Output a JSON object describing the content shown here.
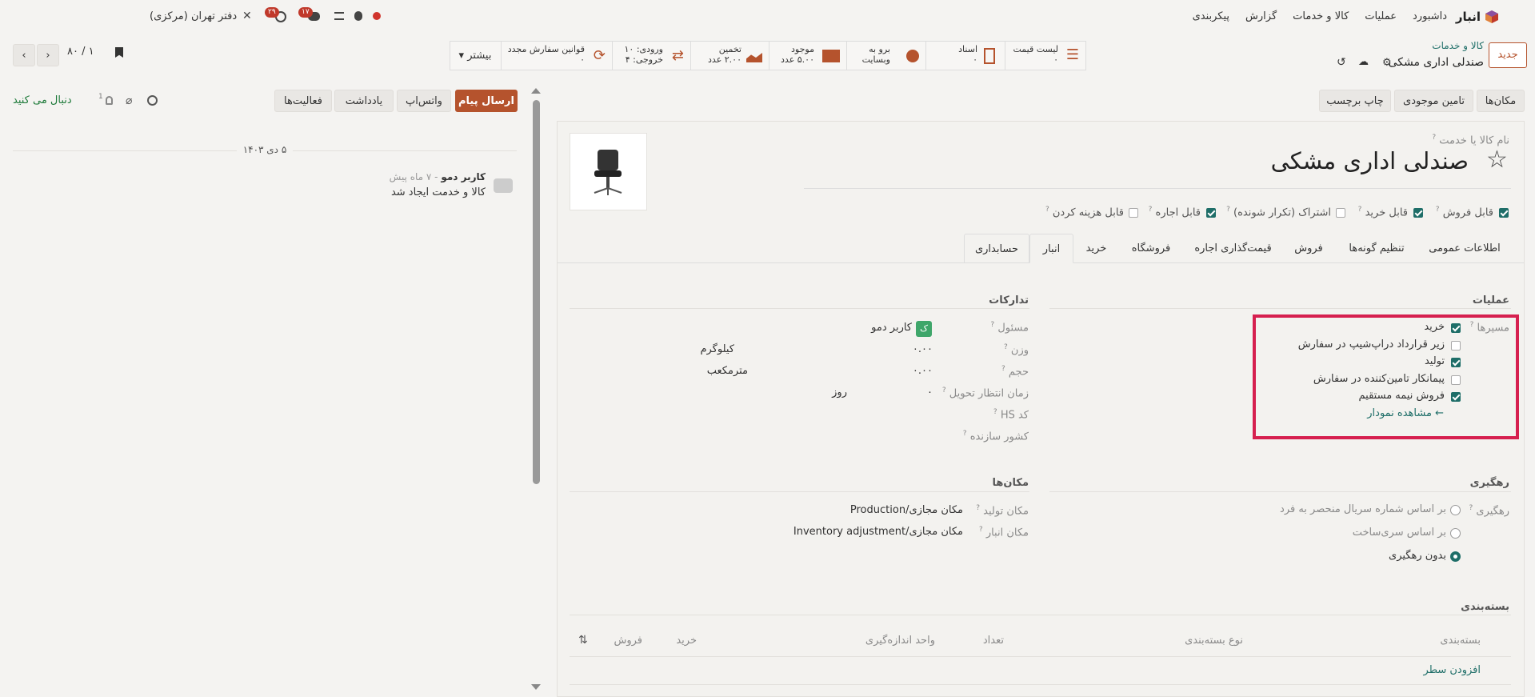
{
  "topbar": {
    "app_name": "انبار",
    "menu": [
      "داشبورد",
      "عملیات",
      "کالا و خدمات",
      "گزارش",
      "پیکربندی"
    ],
    "company": "دفتر تهران (مرکزی)",
    "badge_activity": "۲۹",
    "badge_messages": "۱۷"
  },
  "breadcrumb": {
    "parent": "کالا و خدمات",
    "current": "صندلی اداری مشکی"
  },
  "new_button": "جدید",
  "stats": [
    {
      "label": "لیست قیمت",
      "value": "۰"
    },
    {
      "label": "اسناد",
      "value": "۰"
    },
    {
      "label": "برو به",
      "value": "وبسایت"
    },
    {
      "label": "موجود",
      "value": "۵.۰۰ عدد"
    },
    {
      "label": "تخمین",
      "value": "۲.۰۰ عدد"
    },
    {
      "label": "ورودی: ۱۰",
      "value": "خروجی: ۴"
    },
    {
      "label": "قوانین سفارش مجدد",
      "value": "۰"
    }
  ],
  "more_button": "بیشتر",
  "pager": "۱ / ۸۰",
  "actions": [
    "مکان‌ها",
    "تامین موجودی",
    "چاپ برچسب"
  ],
  "chatter": {
    "send_message": "ارسال پیام",
    "whatsapp": "واتس‌اپ",
    "note": "یادداشت",
    "activities": "فعالیت‌ها",
    "follow": "دنبال می کنید",
    "followers_count": "1",
    "date": "۵ دی ۱۴۰۳",
    "author": "کاربر دمو",
    "time_ago": "- ۷ ماه پیش",
    "message": "کالا و خدمت ایجاد شد"
  },
  "form": {
    "name_label": "نام کالا یا خدمت",
    "product_name": "صندلی اداری مشکی",
    "options": [
      {
        "label": "قابل فروش",
        "checked": true
      },
      {
        "label": "قابل خرید",
        "checked": true
      },
      {
        "label": "اشتراک (تکرار شونده)",
        "checked": false
      },
      {
        "label": "قابل اجاره",
        "checked": true
      },
      {
        "label": "قابل هزینه کردن",
        "checked": false
      }
    ],
    "tabs": [
      "اطلاعات عمومی",
      "تنظیم گونه‌ها",
      "فروش",
      "قیمت‌گذاری اجاره",
      "فروشگاه",
      "خرید",
      "انبار",
      "حسابداری"
    ],
    "active_tab": "انبار"
  },
  "operations": {
    "title": "عملیات",
    "routes_label": "مسیرها",
    "routes": [
      {
        "label": "خرید",
        "checked": true
      },
      {
        "label": "زیر قرارداد دراپ‌شیپ در سفارش",
        "checked": false
      },
      {
        "label": "تولید",
        "checked": true
      },
      {
        "label": "پیمانکار تامین‌کننده در سفارش",
        "checked": false
      },
      {
        "label": "فروش نیمه مستقیم",
        "checked": true
      }
    ],
    "view_diagram": "مشاهده نمودار"
  },
  "logistics": {
    "title": "تدارکات",
    "responsible_label": "مسئول",
    "responsible_avatar": "ک",
    "responsible_value": "کاربر دمو",
    "weight_label": "وزن",
    "weight_value": "۰.۰۰",
    "weight_unit": "کیلوگرم",
    "volume_label": "حجم",
    "volume_value": "۰.۰۰",
    "volume_unit": "مترمکعب",
    "lead_label": "زمان انتظار تحویل",
    "lead_value": "۰",
    "lead_unit": "روز",
    "hs_label": "کد HS",
    "origin_label": "کشور سازنده"
  },
  "tracking": {
    "title": "رهگیری",
    "label": "رهگیری",
    "options": [
      {
        "label": "بر اساس شماره سریال منحصر به فرد",
        "selected": false
      },
      {
        "label": "بر اساس سری‌ساخت",
        "selected": false
      },
      {
        "label": "بدون رهگیری",
        "selected": true
      }
    ]
  },
  "locations": {
    "title": "مکان‌ها",
    "production_label": "مکان تولید",
    "production_value": "مکان مجازی/Production",
    "inventory_label": "مکان انبار",
    "inventory_value": "مکان مجازی/Inventory adjustment"
  },
  "packaging": {
    "title": "بسته‌بندی",
    "columns": [
      "بسته‌بندی",
      "نوع بسته‌بندی",
      "تعداد",
      "واحد اندازه‌گیری",
      "خرید",
      "فروش"
    ],
    "add_line": "افزودن سطر"
  },
  "colors": {
    "brand": "#b5532d",
    "accent": "#1e6e68",
    "highlight": "#d6204f"
  }
}
